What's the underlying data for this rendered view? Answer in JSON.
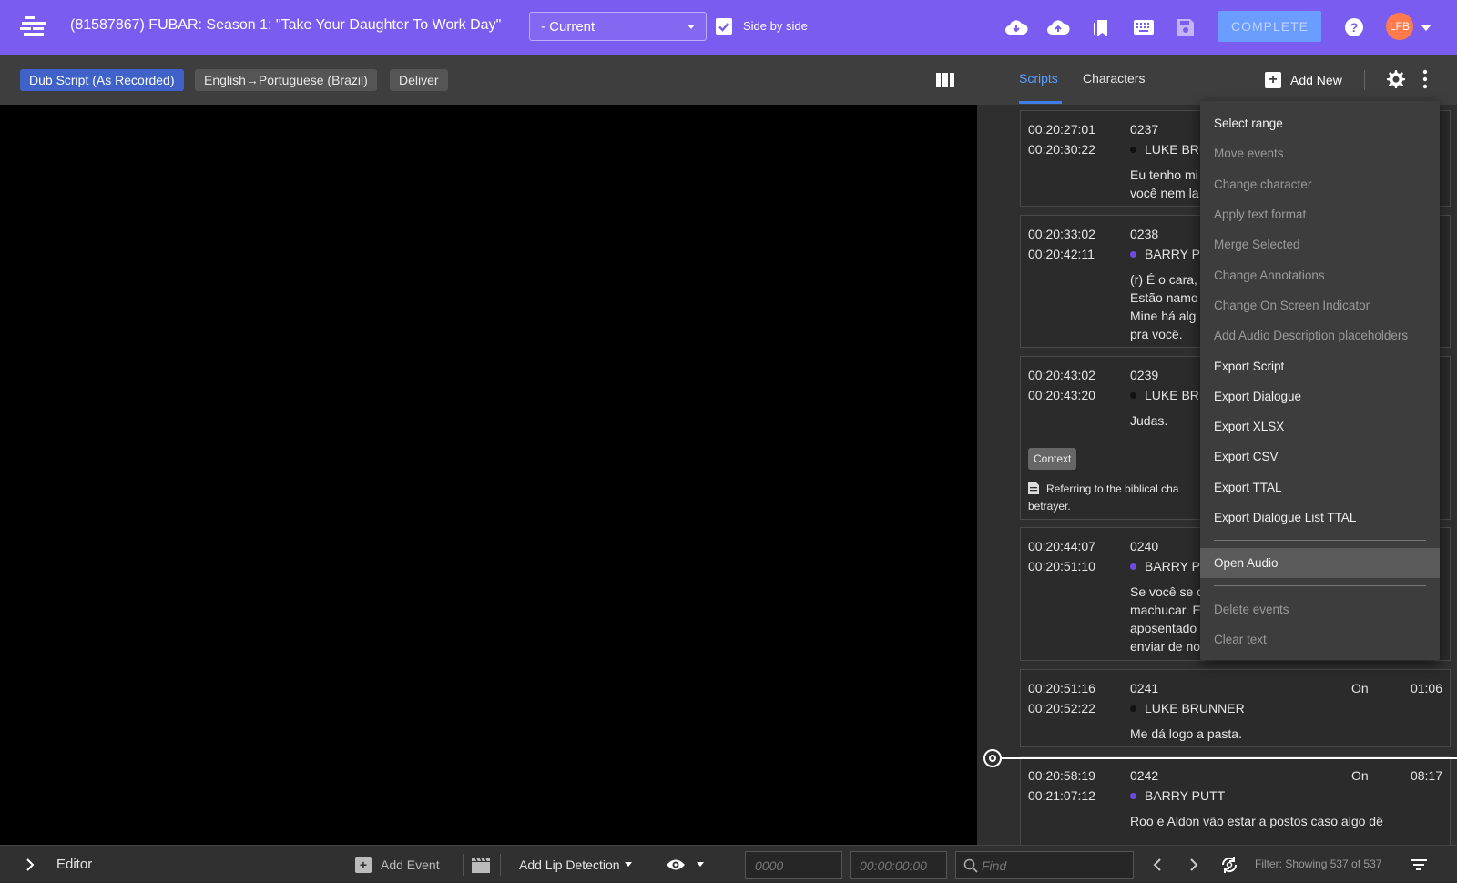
{
  "header": {
    "title": "(81587867) FUBAR: Season 1: \"Take Your Daughter To Work Day\"",
    "version_value": "- Current",
    "side_by_side_label": "Side by side",
    "complete_label": "COMPLETE",
    "avatar_initials": "LFB",
    "icons": [
      "logo-icon",
      "cloud-download-icon",
      "cloud-upload-icon",
      "bookmarks-icon",
      "keyboard-icon",
      "save-icon",
      "help-icon"
    ]
  },
  "subbar": {
    "chips": [
      "Dub Script (As Recorded)",
      "English→Portuguese (Brazil)",
      "Deliver"
    ]
  },
  "right_panel": {
    "tabs": [
      "Scripts",
      "Characters"
    ],
    "add_new_label": "Add New"
  },
  "events": [
    {
      "start": "00:20:27:01",
      "end": "00:20:30:22",
      "num": "0237",
      "character": "LUKE BRU",
      "color": "#111111",
      "lines": [
        "Eu tenho mi",
        "você nem la"
      ]
    },
    {
      "start": "00:20:33:02",
      "end": "00:20:42:11",
      "num": "0238",
      "character": "BARRY PU",
      "color": "#6b4ce6",
      "lines": [
        "(r) É o cara,",
        "Estão namo",
        "Mine há alg",
        "pra você."
      ]
    },
    {
      "start": "00:20:43:02",
      "end": "00:20:43:20",
      "num": "0239",
      "character": "LUKE BRU",
      "color": "#111111",
      "lines": [
        "Judas."
      ],
      "context_label": "Context",
      "context_text": "Referring to the biblical cha",
      "context_text2": "betrayer."
    },
    {
      "start": "00:20:44:07",
      "end": "00:20:51:10",
      "num": "0240",
      "character": "BARRY PI",
      "color": "#6b4ce6",
      "lines": [
        "Se você se c",
        "machucar. E",
        "aposentado",
        "enviar de no"
      ]
    },
    {
      "start": "00:20:51:16",
      "end": "00:20:52:22",
      "num": "0241",
      "character": "LUKE BRUNNER",
      "color": "#111111",
      "lines": [
        "Me dá logo a pasta."
      ],
      "on": "On",
      "dur": "01:06"
    },
    {
      "start": "00:20:58:19",
      "end": "00:21:07:12",
      "num": "0242",
      "character": "BARRY PUTT",
      "color": "#6b4ce6",
      "lines": [
        "Roo e Aldon vão estar a postos caso algo dê"
      ],
      "on": "On",
      "dur": "08:17"
    }
  ],
  "menu": {
    "group1": [
      {
        "label": "Select range",
        "enabled": true
      },
      {
        "label": "Move events",
        "enabled": false
      },
      {
        "label": "Change character",
        "enabled": false
      },
      {
        "label": "Apply text format",
        "enabled": false
      },
      {
        "label": "Merge Selected",
        "enabled": false
      },
      {
        "label": "Change Annotations",
        "enabled": false
      },
      {
        "label": "Change On Screen Indicator",
        "enabled": false
      },
      {
        "label": "Add Audio Description placeholders",
        "enabled": false
      },
      {
        "label": "Export Script",
        "enabled": true
      },
      {
        "label": "Export Dialogue",
        "enabled": true
      },
      {
        "label": "Export XLSX",
        "enabled": true
      },
      {
        "label": "Export CSV",
        "enabled": true
      },
      {
        "label": "Export TTAL",
        "enabled": true
      },
      {
        "label": "Export Dialogue List TTAL",
        "enabled": true
      }
    ],
    "group2": [
      {
        "label": "Open Audio",
        "enabled": true
      }
    ],
    "group3": [
      {
        "label": "Delete events",
        "enabled": false
      },
      {
        "label": "Clear text",
        "enabled": false
      }
    ]
  },
  "bottom": {
    "editor_label": "Editor",
    "add_event_label": "Add Event",
    "lip_detection_label": "Add Lip Detection",
    "event_number_placeholder": "0000",
    "timecode_placeholder": "00:00:00:00",
    "find_placeholder": "Find",
    "filter_text": "Filter: Showing 537 of 537"
  }
}
